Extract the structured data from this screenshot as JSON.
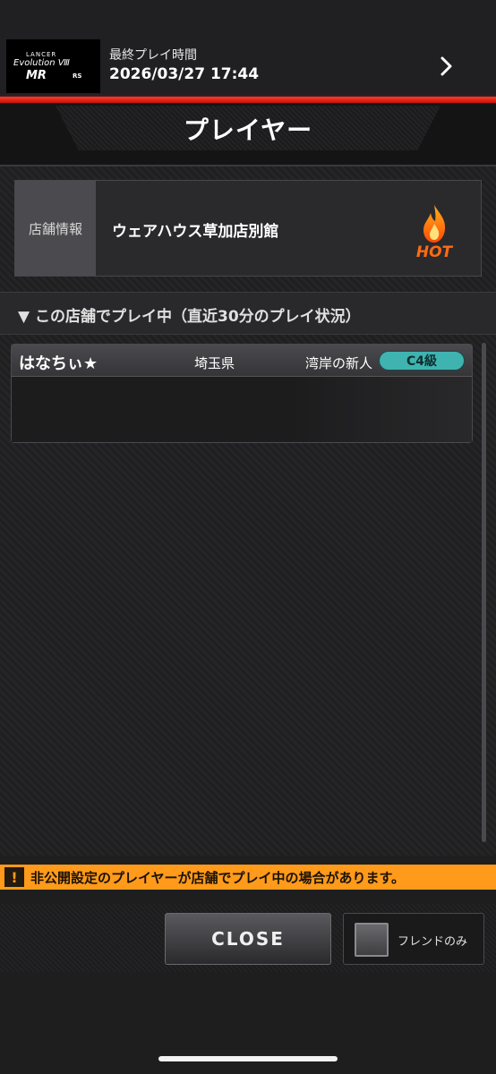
{
  "header": {
    "title": "プレイヤー"
  },
  "store": {
    "label": "店舗情報",
    "name": "ウェアハウス草加店別館",
    "badge": "HOT"
  },
  "section": {
    "title": "▼ この店舗でプレイ中（直近30分のプレイ状況）"
  },
  "players": [
    {
      "name": "はなちぃ★",
      "prefecture": "埼玉県",
      "title": "湾岸の新人",
      "class": "C4級",
      "car_logo": {
        "line1": "LANCER",
        "line2": "Evolution Ⅷ",
        "line3": "MR",
        "line4": "RS"
      },
      "last_play_label": "最終プレイ時間",
      "last_play_time": "2026/03/27 17:44"
    }
  ],
  "notice": {
    "icon": "!",
    "text": "非公開設定のプレイヤーが店舗でプレイ中の場合があります。"
  },
  "footer": {
    "close_label": "CLOSE",
    "friend_only_label": "フレンドのみ"
  },
  "colors": {
    "accent_red": "#e3160c",
    "warning_orange": "#ff9a1a",
    "class_teal": "#3fb3b0",
    "hot_orange": "#ff6a14"
  }
}
